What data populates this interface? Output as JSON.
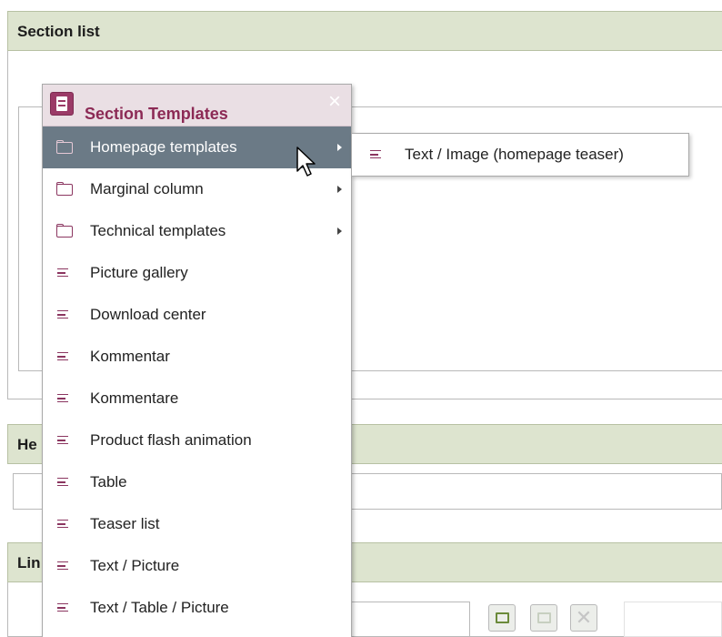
{
  "panels": {
    "section_list": {
      "title": "Section list"
    },
    "headline": {
      "title_fragment": "He"
    },
    "link": {
      "title_fragment": "Lin"
    }
  },
  "popup": {
    "title": "Section Templates",
    "close": "×",
    "items": [
      {
        "label": "Homepage templates",
        "type": "folder",
        "submenu": true,
        "active": true
      },
      {
        "label": "Marginal column",
        "type": "folder",
        "submenu": true
      },
      {
        "label": "Technical templates",
        "type": "folder",
        "submenu": true
      },
      {
        "label": "Picture gallery",
        "type": "template"
      },
      {
        "label": "Download center",
        "type": "template"
      },
      {
        "label": "Kommentar",
        "type": "template"
      },
      {
        "label": "Kommentare",
        "type": "template"
      },
      {
        "label": "Product flash animation",
        "type": "template"
      },
      {
        "label": "Table",
        "type": "template"
      },
      {
        "label": "Teaser list",
        "type": "template"
      },
      {
        "label": "Text / Picture",
        "type": "template"
      },
      {
        "label": "Text / Table / Picture",
        "type": "template"
      }
    ]
  },
  "submenu": {
    "items": [
      {
        "label": "Text / Image (homepage teaser)",
        "type": "template"
      }
    ]
  },
  "colors": {
    "panel_header_bg": "#dde4cf",
    "popup_header_bg": "#eadfe4",
    "accent": "#8c2a55",
    "active_item_bg": "#6b7a86"
  }
}
